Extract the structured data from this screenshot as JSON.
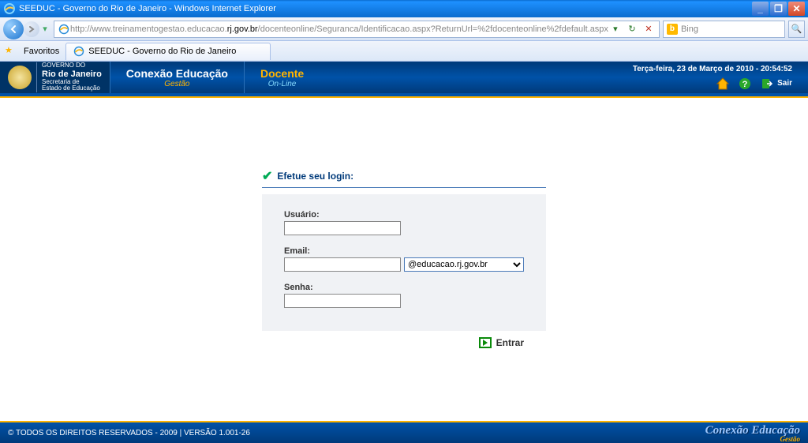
{
  "window": {
    "title": "SEEDUC - Governo do Rio de Janeiro - Windows Internet Explorer"
  },
  "browser": {
    "url_prefix": "http://www.treinamentogestao.educacao.",
    "url_domain": "rj.gov.br",
    "url_suffix": "/docenteonline/Seguranca/Identificacao.aspx?ReturnUrl=%2fdocenteonline%2fdefault.aspx",
    "search_placeholder": "Bing",
    "favorites_label": "Favoritos",
    "tab_title": "SEEDUC - Governo do Rio de Janeiro"
  },
  "header": {
    "logo": {
      "line1": "GOVERNO DO",
      "line2": "Rio de Janeiro",
      "line3": "Secretaria de",
      "line4": "Estado de Educação"
    },
    "section1": {
      "title": "Conexão Educação",
      "subtitle": "Gestão"
    },
    "section2": {
      "title": "Docente",
      "subtitle": "On-Line"
    },
    "datetime": "Terça-feira, 23 de Março de 2010 - 20:54:52",
    "sair_label": "Sair"
  },
  "login": {
    "heading": "Efetue seu login:",
    "usuario_label": "Usuário:",
    "usuario_value": "",
    "email_label": "Email:",
    "email_value": "",
    "email_domain_selected": "@educacao.rj.gov.br",
    "senha_label": "Senha:",
    "senha_value": "",
    "entrar_label": "Entrar"
  },
  "footer": {
    "copyright": "© TODOS OS DIREITOS RESERVADOS - 2009 | VERSÃO 1.001-26",
    "brand": "Conexão Educação",
    "brand_sub": "Gestão"
  }
}
